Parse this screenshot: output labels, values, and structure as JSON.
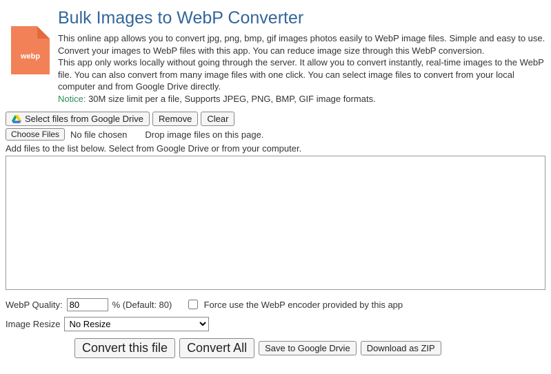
{
  "header": {
    "title": "Bulk Images to WebP Converter",
    "icon_text": "webp",
    "desc1": "This online app allows you to convert jpg, png, bmp, gif images photos easily to WebP image files. Simple and easy to use. Convert your images to WebP files with this app. You can reduce image size through this WebP conversion.",
    "desc2": "This app only works locally without going through the server. It allow you to convert instantly, real-time images to the WebP file. You can also convert from many image files with one click. You can select image files to convert from your local computer and from Google Drive directly.",
    "notice_label": "Notice:",
    "notice_text": " 30M size limit per a file, Supports JPEG, PNG, BMP, GIF image formats."
  },
  "toolbar": {
    "select_drive": "Select files from Google Drive",
    "remove": "Remove",
    "clear": "Clear",
    "choose_files": "Choose Files",
    "no_file": "No file chosen",
    "drop_hint": "Drop image files on this page.",
    "add_hint": "Add files to the list below. Select from Google Drive or from your computer."
  },
  "options": {
    "quality_label": "WebP Quality:",
    "quality_value": "80",
    "quality_suffix": "% (Default: 80)",
    "force_label": "Force use the WebP encoder provided by this app",
    "resize_label": "Image Resize",
    "resize_value": "No Resize"
  },
  "actions": {
    "convert_this": "Convert this file",
    "convert_all": "Convert All",
    "save_drive": "Save to Google Drvie",
    "download_zip": "Download as ZIP"
  }
}
